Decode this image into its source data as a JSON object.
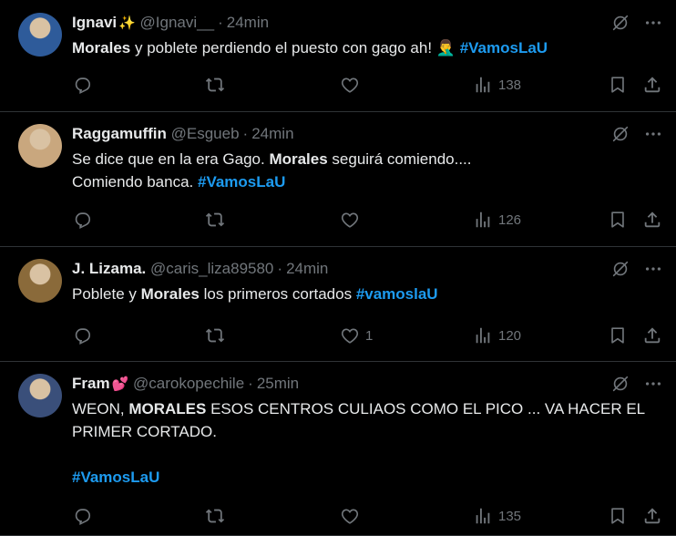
{
  "tweets": [
    {
      "name": "Ignavi",
      "name_emoji": "✨",
      "handle": "@Ignavi__",
      "time": "24min",
      "text": [
        {
          "t": "Morales",
          "s": "b"
        },
        {
          "t": " y poblete perdiendo el puesto con gago ah! ",
          "s": ""
        },
        {
          "t": "🤦‍♂️",
          "s": ""
        },
        {
          "t": " ",
          "s": ""
        },
        {
          "t": "#VamosLaU",
          "s": "tag"
        }
      ],
      "likes": "",
      "views": "138",
      "avatar_color": "#2e5b9a"
    },
    {
      "name": "Raggamuffin",
      "name_emoji": "",
      "handle": "@Esgueb",
      "time": "24min",
      "text": [
        {
          "t": "Se dice que en la era Gago. ",
          "s": ""
        },
        {
          "t": "Morales",
          "s": "b"
        },
        {
          "t": " seguirá comiendo....",
          "s": ""
        },
        {
          "t": "\n",
          "s": "br"
        },
        {
          "t": "Comiendo banca.  ",
          "s": ""
        },
        {
          "t": "#VamosLaU",
          "s": "tag"
        }
      ],
      "likes": "",
      "views": "126",
      "avatar_color": "#c9a77e"
    },
    {
      "name": "J. Lizama.",
      "name_emoji": "",
      "handle": "@caris_liza89580",
      "time": "24min",
      "text": [
        {
          "t": "Poblete y ",
          "s": ""
        },
        {
          "t": "Morales",
          "s": "b"
        },
        {
          "t": " los primeros cortados ",
          "s": ""
        },
        {
          "t": "#vamoslaU",
          "s": "tag"
        }
      ],
      "likes": "1",
      "views": "120",
      "avatar_color": "#8a6a3a"
    },
    {
      "name": "Fram",
      "name_emoji": "💕",
      "handle": "@carokopechile",
      "time": "25min",
      "text": [
        {
          "t": "WEON, ",
          "s": ""
        },
        {
          "t": "MORALES",
          "s": "b"
        },
        {
          "t": " ESOS CENTROS CULIAOS COMO EL PICO ... VA HACER EL PRIMER CORTADO.",
          "s": ""
        },
        {
          "t": "\n",
          "s": "br"
        },
        {
          "t": "\n",
          "s": "br"
        },
        {
          "t": "#VamosLaU",
          "s": "tag"
        }
      ],
      "likes": "",
      "views": "135",
      "avatar_color": "#3a4f7a"
    }
  ],
  "icons": {
    "grok": "grok-icon",
    "more": "more-icon",
    "reply": "reply-icon",
    "retweet": "retweet-icon",
    "like": "like-icon",
    "views": "views-icon",
    "bookmark": "bookmark-icon",
    "share": "share-icon"
  },
  "colors": {
    "background": "#000000",
    "text": "#e7e9ea",
    "secondary": "#71767b",
    "link": "#1d9bf0",
    "divider": "#2f3336"
  }
}
